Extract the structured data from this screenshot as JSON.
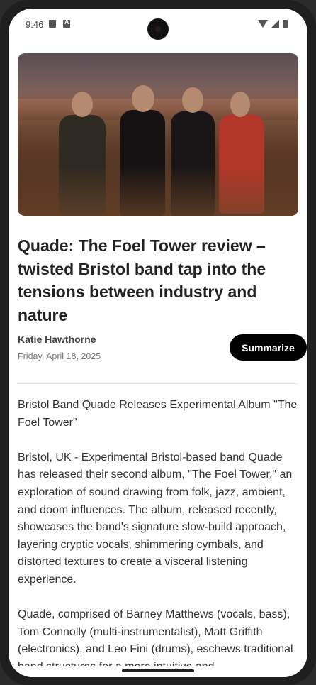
{
  "status_bar": {
    "time": "9:46"
  },
  "article": {
    "image_alt": "Four band members standing in a field at dusk",
    "title": "Quade: The Foel Tower review – twisted Bristol band tap into the tensions between industry and nature",
    "author": "Katie Hawthorne",
    "date": "Friday, April 18, 2025",
    "summarize_label": "Summarize",
    "paragraphs": [
      " Bristol Band Quade Releases Experimental Album \"The Foel Tower\"",
      "Bristol, UK - Experimental Bristol-based band Quade has released their second album, \"The Foel Tower,\" an exploration of sound drawing from folk, jazz, ambient, and doom influences. The album, released recently, showcases the band's signature slow-build approach, layering cryptic vocals, shimmering cymbals, and distorted textures to create a visceral listening experience.",
      "Quade, comprised of Barney Matthews (vocals, bass), Tom Connolly (multi-instrumentalist), Matt Griffith (electronics), and Leo Fini (drums), eschews traditional band structures for a more intuitive and"
    ]
  },
  "colors": {
    "button_bg": "#000000",
    "button_text": "#ffffff",
    "title_text": "#222222"
  }
}
